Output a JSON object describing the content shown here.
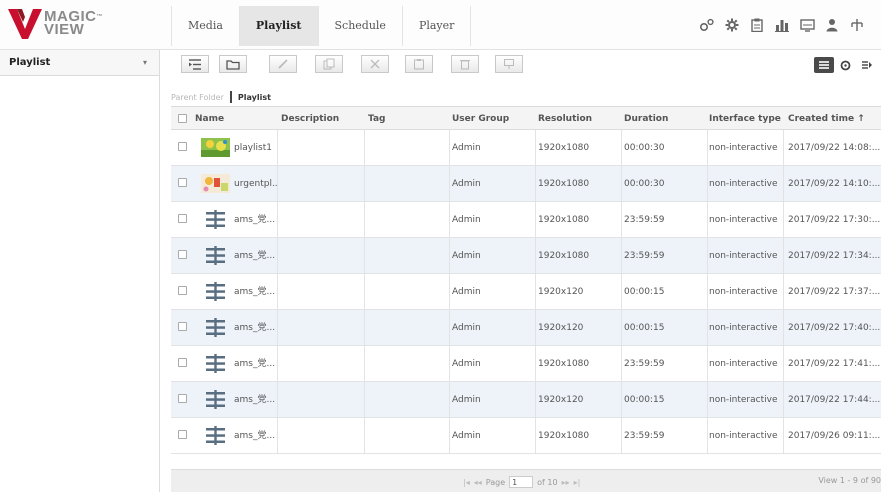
{
  "brand": {
    "line1": "MAGIC",
    "line2": "VIEW",
    "tm": "™"
  },
  "nav": {
    "tabs": [
      {
        "label": "Media"
      },
      {
        "label": "Playlist"
      },
      {
        "label": "Schedule"
      },
      {
        "label": "Player"
      }
    ],
    "active": "Playlist"
  },
  "header_tools": [
    "settings-gears-icon",
    "gear-icon",
    "clipboard-icon",
    "bar-chart-icon",
    "monitor-icon",
    "user-icon",
    "network-icon"
  ],
  "sidebar": {
    "title": "Playlist"
  },
  "toolbar": {
    "buttons": [
      "indent-icon",
      "folder-icon",
      "edit-icon",
      "copy-icon",
      "cut-icon",
      "paste-icon",
      "delete-icon",
      "publish-icon"
    ],
    "view_modes": [
      "list-view-icon",
      "refresh-icon",
      "details-icon"
    ]
  },
  "breadcrumb": {
    "parent": "Parent Folder",
    "current": "Playlist"
  },
  "table": {
    "columns": [
      "Name",
      "Description",
      "Tag",
      "User Group",
      "Resolution",
      "Duration",
      "Interface type",
      "Created time ↑"
    ],
    "rows": [
      {
        "name": "playlist1",
        "thumb": "image",
        "description": "",
        "tag": "",
        "group": "Admin",
        "resolution": "1920x1080",
        "duration": "00:00:30",
        "interface": "non-interactive",
        "created": "2017/09/22 14:08:..."
      },
      {
        "name": "urgentpl...",
        "thumb": "image-urgent",
        "description": "",
        "tag": "",
        "group": "Admin",
        "resolution": "1920x1080",
        "duration": "00:00:30",
        "interface": "non-interactive",
        "created": "2017/09/22 14:10:..."
      },
      {
        "name": "ams_党...",
        "thumb": "playlist-icon",
        "description": "",
        "tag": "",
        "group": "Admin",
        "resolution": "1920x1080",
        "duration": "23:59:59",
        "interface": "non-interactive",
        "created": "2017/09/22 17:30:..."
      },
      {
        "name": "ams_党...",
        "thumb": "playlist-icon",
        "description": "",
        "tag": "",
        "group": "Admin",
        "resolution": "1920x1080",
        "duration": "23:59:59",
        "interface": "non-interactive",
        "created": "2017/09/22 17:34:..."
      },
      {
        "name": "ams_党...",
        "thumb": "playlist-icon",
        "description": "",
        "tag": "",
        "group": "Admin",
        "resolution": "1920x120",
        "duration": "00:00:15",
        "interface": "non-interactive",
        "created": "2017/09/22 17:37:..."
      },
      {
        "name": "ams_党...",
        "thumb": "playlist-icon",
        "description": "",
        "tag": "",
        "group": "Admin",
        "resolution": "1920x120",
        "duration": "00:00:15",
        "interface": "non-interactive",
        "created": "2017/09/22 17:40:..."
      },
      {
        "name": "ams_党...",
        "thumb": "playlist-icon",
        "description": "",
        "tag": "",
        "group": "Admin",
        "resolution": "1920x1080",
        "duration": "23:59:59",
        "interface": "non-interactive",
        "created": "2017/09/22 17:41:..."
      },
      {
        "name": "ams_党...",
        "thumb": "playlist-icon",
        "description": "",
        "tag": "",
        "group": "Admin",
        "resolution": "1920x120",
        "duration": "00:00:15",
        "interface": "non-interactive",
        "created": "2017/09/22 17:44:..."
      },
      {
        "name": "ams_党...",
        "thumb": "playlist-icon",
        "description": "",
        "tag": "",
        "group": "Admin",
        "resolution": "1920x1080",
        "duration": "23:59:59",
        "interface": "non-interactive",
        "created": "2017/09/26 09:11:..."
      }
    ]
  },
  "pager": {
    "first": "|◂",
    "prev": "◂◂",
    "page_label": "Page",
    "page_value": "1",
    "of_text": "of 10",
    "next": "▸▸",
    "last": "▸|",
    "view_info": "View 1 - 9 of 90"
  },
  "colors": {
    "brand_red": "#c8102e",
    "active_tab": "#e6e6e6",
    "row_alt": "#eef3fa"
  }
}
